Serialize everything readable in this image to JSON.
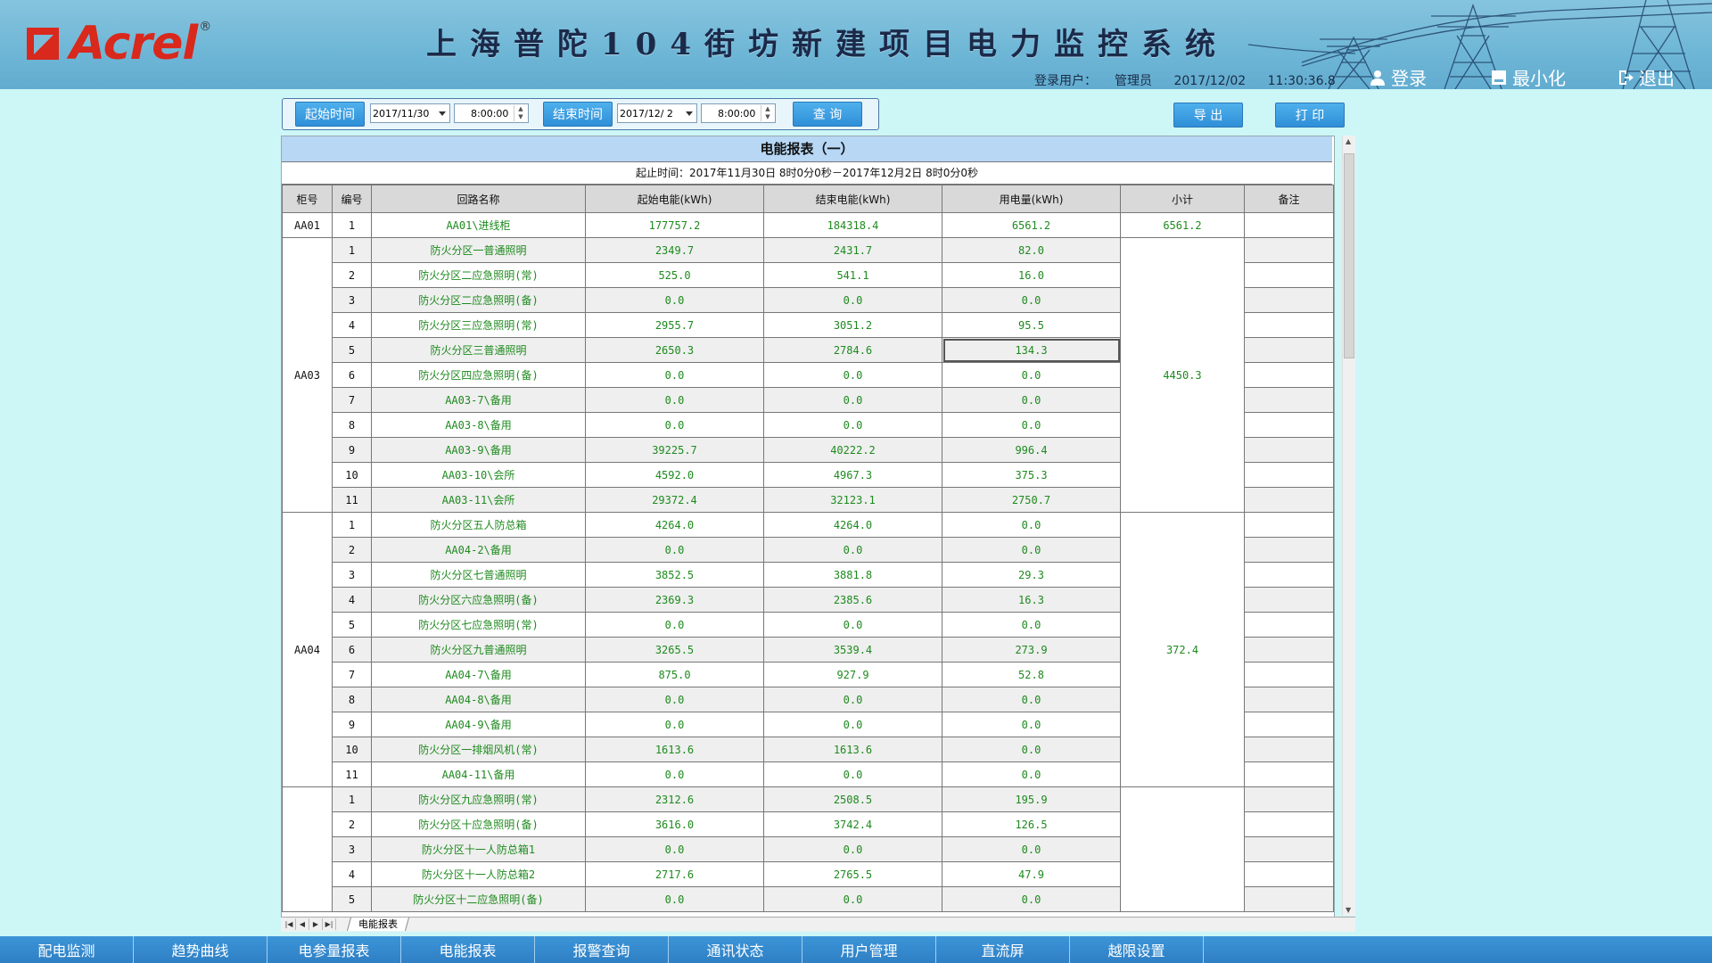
{
  "header": {
    "logo_text": "Acrel",
    "logo_reg": "®",
    "title": "上海普陀104街坊新建项目电力监控系统",
    "login_user_label": "登录用户：",
    "login_user": "管理员",
    "date": "2017/12/02",
    "time": "11:30:36.8",
    "btn_login": "登录",
    "btn_minimize": "最小化",
    "btn_exit": "退出"
  },
  "query": {
    "start_label": "起始时间",
    "start_date": "2017/11/30",
    "start_time": "8:00:00",
    "end_label": "结束时间",
    "end_date": "2017/12/ 2",
    "end_time": "8:00:00",
    "search_btn": "查 询",
    "export_btn": "导 出",
    "print_btn": "打 印"
  },
  "report": {
    "title": "电能报表（一）",
    "subtitle": "起止时间：2017年11月30日 8时0分0秒－2017年12月2日 8时0分0秒",
    "columns": [
      "柜号",
      "编号",
      "回路名称",
      "起始电能(kWh)",
      "结束电能(kWh)",
      "用电量(kWh)",
      "小计",
      "备注"
    ],
    "groups": [
      {
        "cabinet": "AA01",
        "subtotal": "6561.2",
        "rows": [
          [
            "1",
            "AA01\\进线柜",
            "177757.2",
            "184318.4",
            "6561.2"
          ]
        ]
      },
      {
        "cabinet": "AA03",
        "subtotal": "4450.3",
        "rows": [
          [
            "1",
            "防火分区一普通照明",
            "2349.7",
            "2431.7",
            "82.0"
          ],
          [
            "2",
            "防火分区二应急照明(常)",
            "525.0",
            "541.1",
            "16.0"
          ],
          [
            "3",
            "防火分区二应急照明(备)",
            "0.0",
            "0.0",
            "0.0"
          ],
          [
            "4",
            "防火分区三应急照明(常)",
            "2955.7",
            "3051.2",
            "95.5"
          ],
          [
            "5",
            "防火分区三普通照明",
            "2650.3",
            "2784.6",
            "134.3"
          ],
          [
            "6",
            "防火分区四应急照明(备)",
            "0.0",
            "0.0",
            "0.0"
          ],
          [
            "7",
            "AA03-7\\备用",
            "0.0",
            "0.0",
            "0.0"
          ],
          [
            "8",
            "AA03-8\\备用",
            "0.0",
            "0.0",
            "0.0"
          ],
          [
            "9",
            "AA03-9\\备用",
            "39225.7",
            "40222.2",
            "996.4"
          ],
          [
            "10",
            "AA03-10\\会所",
            "4592.0",
            "4967.3",
            "375.3"
          ],
          [
            "11",
            "AA03-11\\会所",
            "29372.4",
            "32123.1",
            "2750.7"
          ]
        ]
      },
      {
        "cabinet": "AA04",
        "subtotal": "372.4",
        "rows": [
          [
            "1",
            "防火分区五人防总箱",
            "4264.0",
            "4264.0",
            "0.0"
          ],
          [
            "2",
            "AA04-2\\备用",
            "0.0",
            "0.0",
            "0.0"
          ],
          [
            "3",
            "防火分区七普通照明",
            "3852.5",
            "3881.8",
            "29.3"
          ],
          [
            "4",
            "防火分区六应急照明(备)",
            "2369.3",
            "2385.6",
            "16.3"
          ],
          [
            "5",
            "防火分区七应急照明(常)",
            "0.0",
            "0.0",
            "0.0"
          ],
          [
            "6",
            "防火分区九普通照明",
            "3265.5",
            "3539.4",
            "273.9"
          ],
          [
            "7",
            "AA04-7\\备用",
            "875.0",
            "927.9",
            "52.8"
          ],
          [
            "8",
            "AA04-8\\备用",
            "0.0",
            "0.0",
            "0.0"
          ],
          [
            "9",
            "AA04-9\\备用",
            "0.0",
            "0.0",
            "0.0"
          ],
          [
            "10",
            "防火分区一排烟风机(常)",
            "1613.6",
            "1613.6",
            "0.0"
          ],
          [
            "11",
            "AA04-11\\备用",
            "0.0",
            "0.0",
            "0.0"
          ]
        ]
      },
      {
        "cabinet": "",
        "subtotal": "",
        "rows": [
          [
            "1",
            "防火分区九应急照明(常)",
            "2312.6",
            "2508.5",
            "195.9"
          ],
          [
            "2",
            "防火分区十应急照明(备)",
            "3616.0",
            "3742.4",
            "126.5"
          ],
          [
            "3",
            "防火分区十一人防总箱1",
            "0.0",
            "0.0",
            "0.0"
          ],
          [
            "4",
            "防火分区十一人防总箱2",
            "2717.6",
            "2765.5",
            "47.9"
          ],
          [
            "5",
            "防火分区十二应急照明(备)",
            "0.0",
            "0.0",
            "0.0"
          ]
        ]
      }
    ],
    "sheet_tab": "电能报表"
  },
  "nav": [
    "配电监测",
    "趋势曲线",
    "电参量报表",
    "电能报表",
    "报警查询",
    "通讯状态",
    "用户管理",
    "直流屏",
    "越限设置"
  ],
  "colors": {
    "accent": "#2f8fd8",
    "value_green": "#1e8a1e",
    "header_bg": "#6eb6d6",
    "page_bg": "#cdf6f7"
  }
}
